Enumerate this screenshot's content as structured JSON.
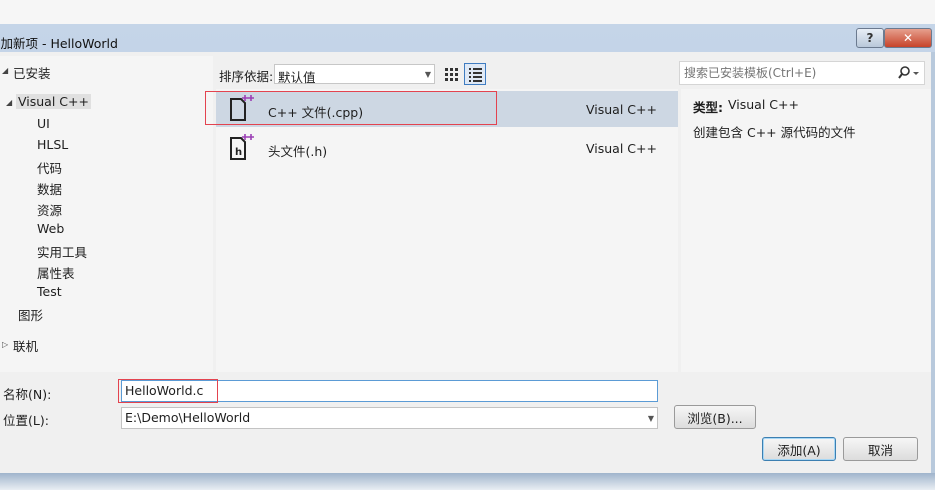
{
  "window": {
    "title": "添加新项 - HelloWorld",
    "help_label": "?",
    "close_label": "✕"
  },
  "tree": {
    "installed": "已安装",
    "visual_cpp": "Visual C++",
    "children": [
      "UI",
      "HLSL",
      "代码",
      "数据",
      "资源",
      "Web",
      "实用工具",
      "属性表",
      "Test"
    ],
    "graphics": "图形",
    "online": "联机"
  },
  "toolbar": {
    "sort_label": "排序依据:",
    "sort_value": "默认值"
  },
  "templates": [
    {
      "name": "C++ 文件(.cpp)",
      "type": "Visual C++",
      "icon": "cpp-file-icon"
    },
    {
      "name": "头文件(.h)",
      "type": "Visual C++",
      "icon": "header-file-icon"
    }
  ],
  "search": {
    "placeholder": "搜索已安装模板(Ctrl+E)"
  },
  "details": {
    "type_label": "类型:",
    "type_value": "Visual C++",
    "description": "创建包含 C++ 源代码的文件"
  },
  "form": {
    "name_label": "名称(N):",
    "name_value": "HelloWorld.c",
    "location_label": "位置(L):",
    "location_value": "E:\\Demo\\HelloWorld",
    "browse_label": "浏览(B)...",
    "add_label": "添加(A)",
    "cancel_label": "取消"
  },
  "colors": {
    "selection": "#cdd7e3",
    "highlight_box": "#e3434f",
    "accent_icon": "#9b3fb5"
  }
}
